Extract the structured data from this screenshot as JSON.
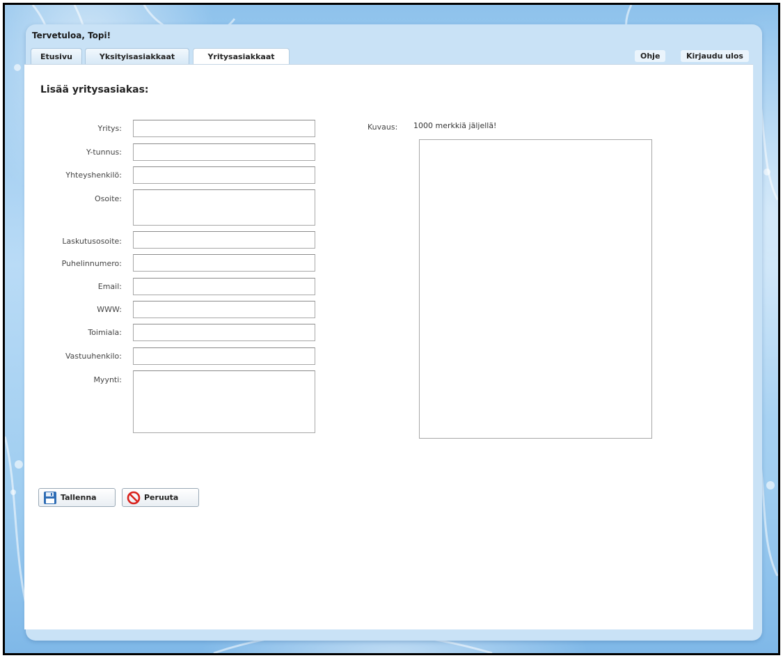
{
  "header": {
    "welcome": "Tervetuloa, Topi!"
  },
  "tabs": [
    {
      "label": "Etusivu",
      "active": false
    },
    {
      "label": "Yksityisasiakkaat",
      "active": false
    },
    {
      "label": "Yritysasiakkaat",
      "active": true
    }
  ],
  "top_links": {
    "help": "Ohje",
    "logout": "Kirjaudu ulos"
  },
  "form": {
    "title": "Lisää yritysasiakas:",
    "fields": [
      {
        "label": "Yritys:",
        "value": ""
      },
      {
        "label": "Y-tunnus:",
        "value": ""
      },
      {
        "label": "Yhteyshenkilö:",
        "value": ""
      },
      {
        "label": "Osoite:",
        "value": ""
      },
      {
        "label": "Laskutusosoite:",
        "value": ""
      },
      {
        "label": "Puhelinnumero:",
        "value": ""
      },
      {
        "label": "Email:",
        "value": ""
      },
      {
        "label": "WWW:",
        "value": ""
      },
      {
        "label": "Toimiala:",
        "value": ""
      },
      {
        "label": "Vastuuhenkilo:",
        "value": ""
      },
      {
        "label": "Myynti:",
        "value": ""
      }
    ],
    "description": {
      "label": "Kuvaus:",
      "remaining": "1000 merkkiä jäljellä!",
      "value": ""
    }
  },
  "buttons": {
    "save": "Tallenna",
    "cancel": "Peruuta"
  },
  "colors": {
    "background_blue": "#9fcdf0",
    "panel_blue": "#c9e2f6",
    "save_icon": "#2f6db5",
    "cancel_icon": "#d9221c"
  },
  "icons": {
    "save": "floppy-disk-icon",
    "cancel": "prohibited-icon"
  }
}
